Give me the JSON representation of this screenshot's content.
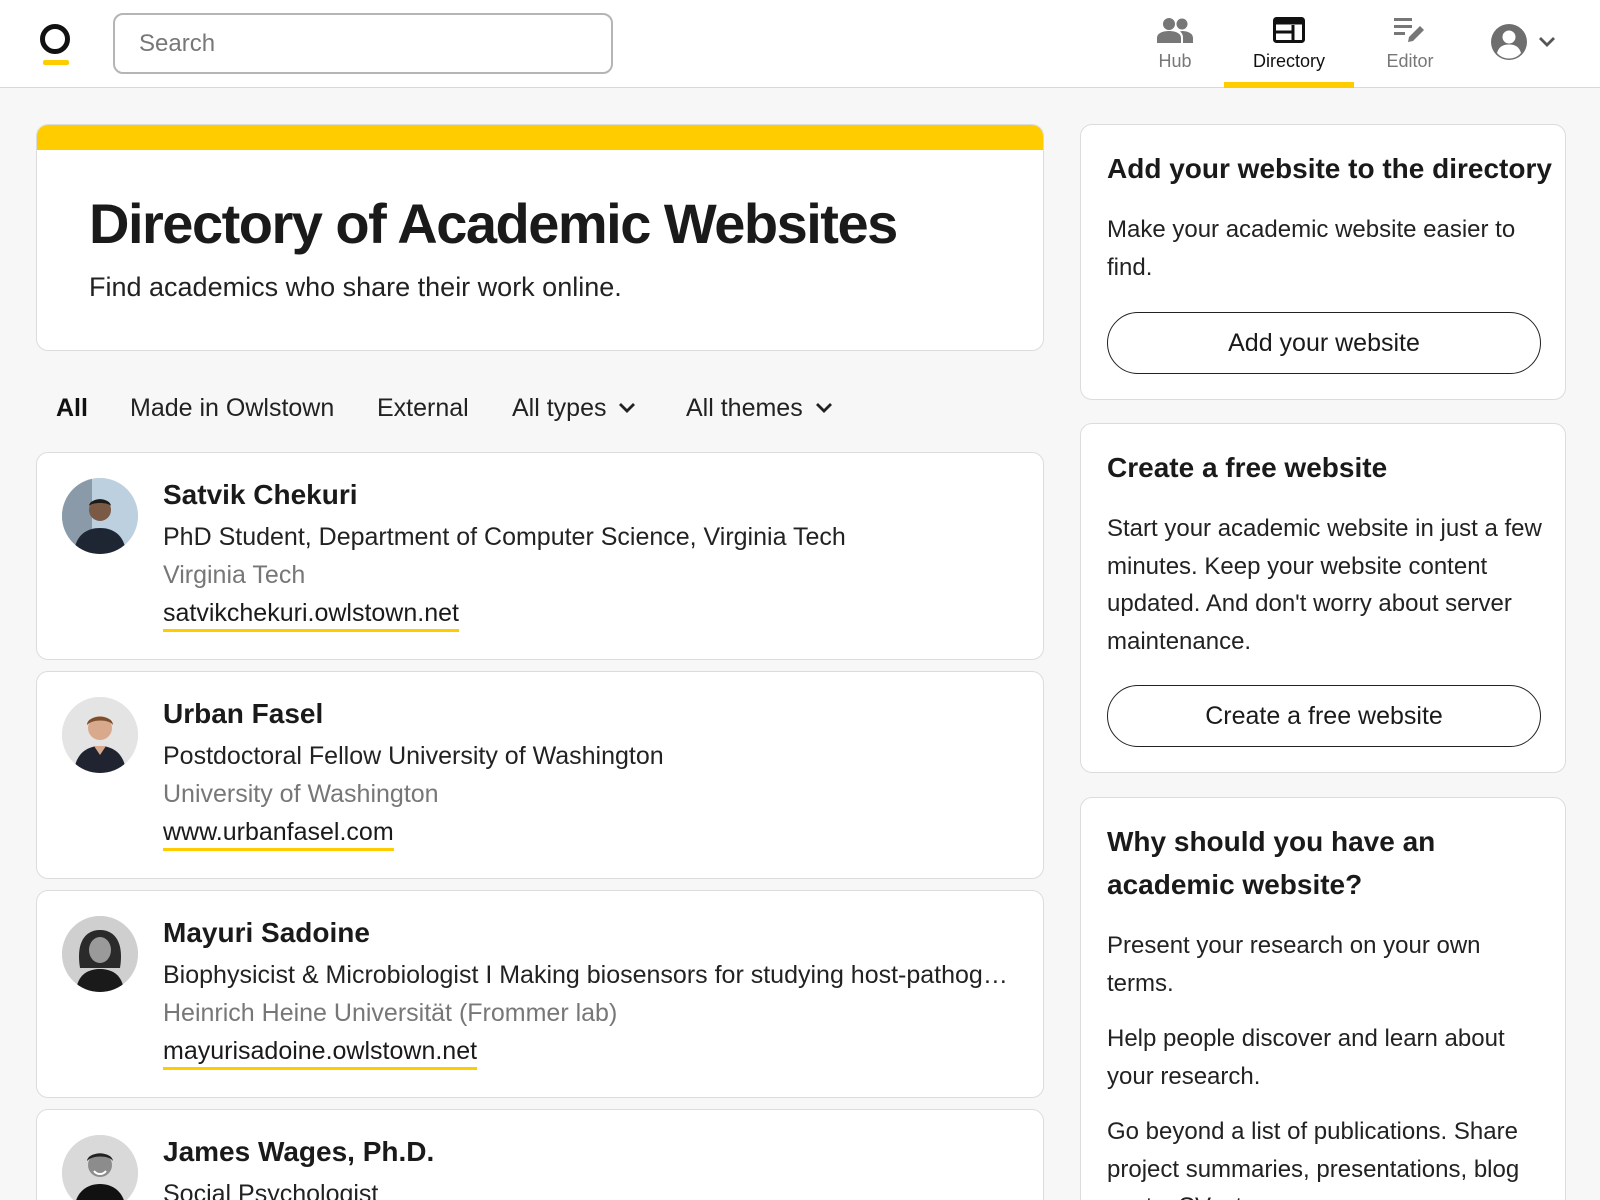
{
  "header": {
    "search_placeholder": "Search",
    "nav": [
      {
        "label": "Hub",
        "icon": "people-icon"
      },
      {
        "label": "Directory",
        "icon": "directory-icon",
        "active": true
      },
      {
        "label": "Editor",
        "icon": "editor-icon"
      }
    ],
    "accent_color": "#ffcc00"
  },
  "hero": {
    "title": "Directory of Academic Websites",
    "subtitle": "Find academics who share their work online."
  },
  "filters": {
    "all": "All",
    "made_in_owlstown": "Made in Owlstown",
    "external": "External",
    "types": "All types",
    "themes": "All themes"
  },
  "people": [
    {
      "name": "Satvik Chekuri",
      "title": "PhD Student, Department of Computer Science, Virginia Tech",
      "institution": "Virginia Tech",
      "url": "satvikchekuri.owlstown.net"
    },
    {
      "name": "Urban Fasel",
      "title": "Postdoctoral Fellow University of Washington",
      "institution": "University of Washington",
      "url": "www.urbanfasel.com"
    },
    {
      "name": "Mayuri Sadoine",
      "title": "Biophysicist & Microbiologist I Making biosensors for studying host-pathogen interactions",
      "institution": "Heinrich Heine Universität (Frommer lab)",
      "url": "mayurisadoine.owlstown.net"
    },
    {
      "name": "James Wages, Ph.D.",
      "title": "Social Psychologist",
      "institution": "",
      "url": ""
    }
  ],
  "sidebar": {
    "add": {
      "title": "Add your website to the directory",
      "text": "Make your academic website easier to find.",
      "button": "Add your website"
    },
    "create": {
      "title": "Create a free website",
      "text": "Start your academic website in just a few minutes. Keep your website content updated. And don't worry about server maintenance.",
      "button": "Create a free website"
    },
    "why": {
      "title": "Why should you have an academic website?",
      "p1": "Present your research on your own terms.",
      "p2": "Help people discover and learn about your research.",
      "p3": "Go beyond a list of publications. Share project summaries, presentations, blog posts, CV, etc."
    }
  }
}
